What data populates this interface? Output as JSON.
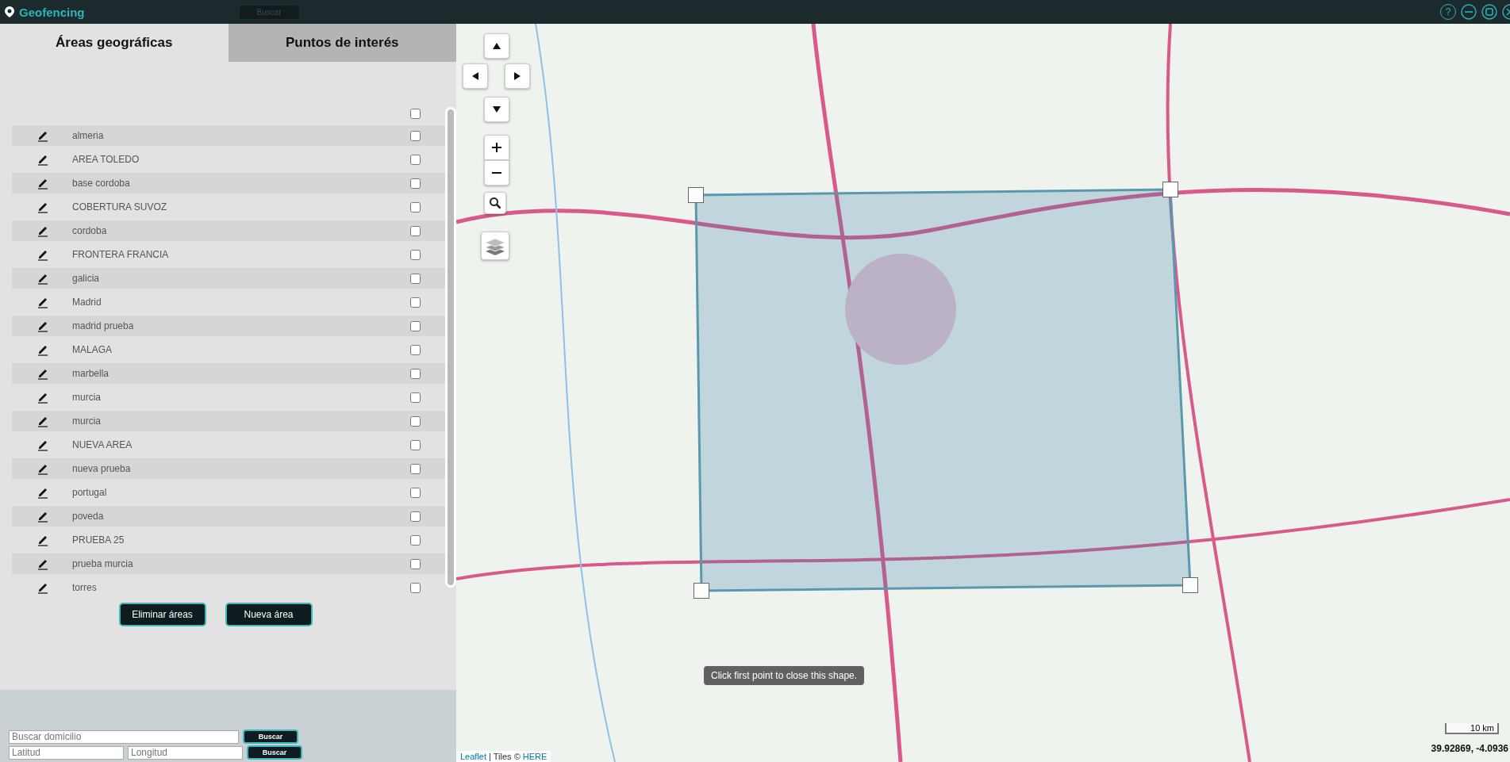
{
  "header": {
    "title": "Geofencing",
    "ghost_button": "Buscar",
    "help": "?"
  },
  "tabs": [
    {
      "label": "Áreas geográficas",
      "selected": true
    },
    {
      "label": "Puntos de interés",
      "selected": false
    }
  ],
  "select_all": {
    "checked": false
  },
  "areas": [
    {
      "name": "almeria",
      "checked": false
    },
    {
      "name": "AREA TOLEDO",
      "checked": false
    },
    {
      "name": "base cordoba",
      "checked": false
    },
    {
      "name": "COBERTURA SUVOZ",
      "checked": false
    },
    {
      "name": "cordoba",
      "checked": false
    },
    {
      "name": "FRONTERA FRANCIA",
      "checked": false
    },
    {
      "name": "galicia",
      "checked": false
    },
    {
      "name": "Madrid",
      "checked": false
    },
    {
      "name": "madrid prueba",
      "checked": false
    },
    {
      "name": "MALAGA",
      "checked": false
    },
    {
      "name": "marbella",
      "checked": false
    },
    {
      "name": "murcia",
      "checked": false
    },
    {
      "name": "murcia",
      "checked": false
    },
    {
      "name": "NUEVA AREA",
      "checked": false
    },
    {
      "name": "nueva prueba",
      "checked": false
    },
    {
      "name": "portugal",
      "checked": false
    },
    {
      "name": "poveda",
      "checked": false
    },
    {
      "name": "PRUEBA 25",
      "checked": false
    },
    {
      "name": "prueba murcia",
      "checked": false
    },
    {
      "name": "torres",
      "checked": false
    }
  ],
  "actions": [
    "Eliminar áreas",
    "Nueva área"
  ],
  "search": {
    "address": {
      "placeholder": "Buscar domicilio"
    },
    "latitude": {
      "placeholder": "Latitud"
    },
    "longitude": {
      "placeholder": "Longitud"
    },
    "buttons": [
      "Buscar",
      "Buscar"
    ]
  },
  "map": {
    "tooltip": "Click first point to close this shape.",
    "scale": "10 km",
    "coordinates": "39.92869, -4.0936",
    "attribution": {
      "link": "Leaflet",
      "separator": "| Tiles ©",
      "provider": "HERE"
    }
  }
}
